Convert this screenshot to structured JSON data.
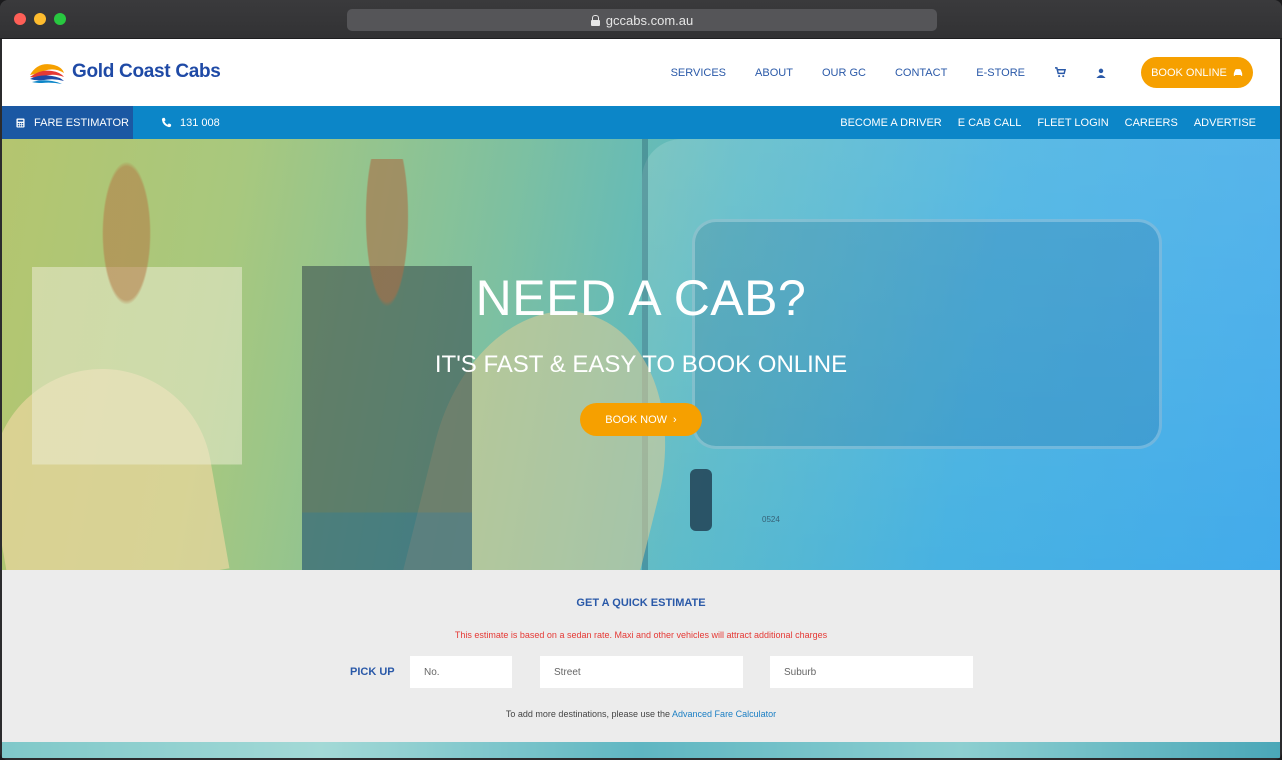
{
  "browser": {
    "url": "gccabs.com.au"
  },
  "header": {
    "logo_text": "Gold Coast Cabs",
    "nav": [
      "SERVICES",
      "ABOUT",
      "OUR GC",
      "CONTACT",
      "E-STORE"
    ],
    "cart_icon": "cart-icon",
    "user_icon": "user-icon",
    "book_online_label": "BOOK ONLINE",
    "book_online_icon": "car-icon"
  },
  "subbar": {
    "fare_estimator_label": "FARE ESTIMATOR",
    "phone": "131 008",
    "links": [
      "BECOME A DRIVER",
      "E CAB CALL",
      "FLEET LOGIN",
      "CAREERS",
      "ADVERTISE"
    ]
  },
  "hero": {
    "title": "NEED A CAB?",
    "subtitle": "IT'S FAST & EASY TO BOOK ONLINE",
    "book_now_label": "BOOK NOW",
    "van_number": "0524"
  },
  "estimator": {
    "title": "GET A QUICK ESTIMATE",
    "note": "This estimate is based on a sedan rate. Maxi and other vehicles will attract additional charges",
    "pickup_label": "PICK UP",
    "fields": {
      "no_placeholder": "No.",
      "street_placeholder": "Street",
      "suburb_placeholder": "Suburb"
    },
    "more_text": "To add more destinations, please use the",
    "more_link": "Advanced Fare Calculator"
  },
  "colors": {
    "brand_blue": "#1f4aa6",
    "bar_blue": "#0c86c8",
    "accent_orange": "#f6a000",
    "warning_red": "#e53935"
  }
}
